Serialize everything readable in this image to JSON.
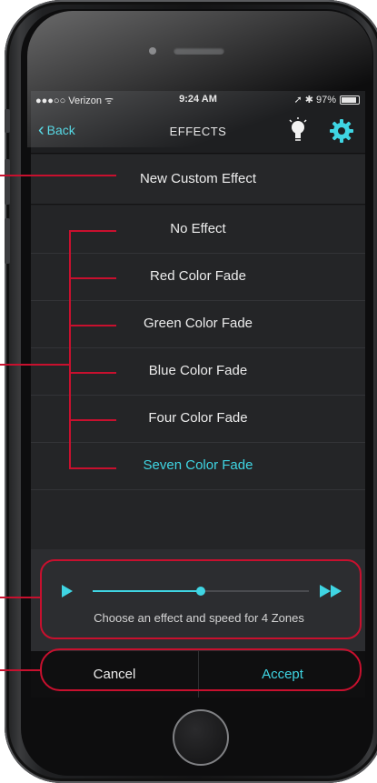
{
  "status_bar": {
    "carrier": "●●●○○ Verizon ᯤ",
    "time": "9:24 AM",
    "battery": "➚ ✱ 97%"
  },
  "nav": {
    "back_label": "Back",
    "title": "EFFECTS",
    "icons": [
      "chevron-left-icon",
      "lightbulb-icon",
      "gear-icon"
    ]
  },
  "custom_effect_label": "New Custom Effect",
  "effects": [
    {
      "label": "No Effect",
      "selected": false
    },
    {
      "label": "Red Color Fade",
      "selected": false
    },
    {
      "label": "Green Color Fade",
      "selected": false
    },
    {
      "label": "Blue Color Fade",
      "selected": false
    },
    {
      "label": "Four Color Fade",
      "selected": false
    },
    {
      "label": "Seven Color Fade",
      "selected": true
    }
  ],
  "speed": {
    "value": 0.5,
    "caption": "Choose an effect and speed for 4 Zones",
    "icons": [
      "play-icon",
      "fast-forward-icon"
    ]
  },
  "actions": {
    "cancel_label": "Cancel",
    "accept_label": "Accept"
  },
  "colors": {
    "accent": "#3fd5e3",
    "annotation": "#c8102e",
    "screen_bg": "#1e1f21"
  }
}
